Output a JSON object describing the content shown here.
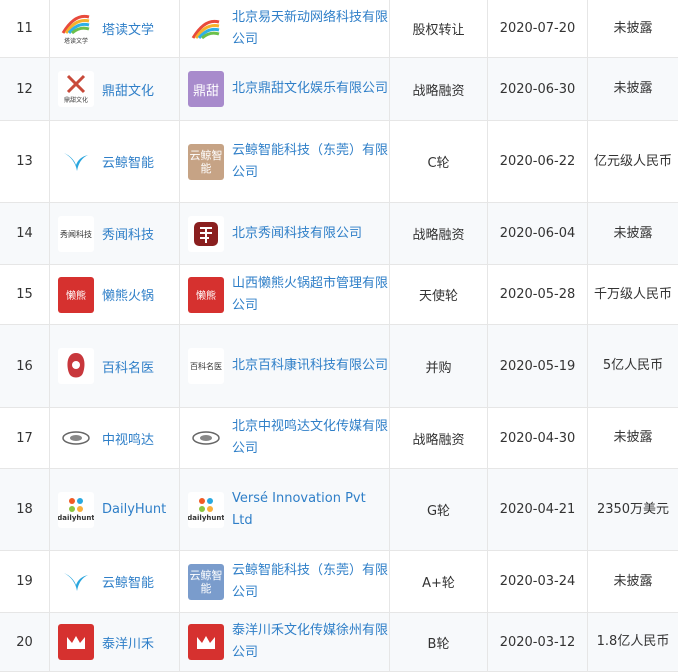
{
  "rows": [
    {
      "idx": "11",
      "project": "塔读文学",
      "company": "北京易天新动网络科技有限公司",
      "round": "股权转让",
      "date": "2020-07-20",
      "amount": "未披露",
      "proj_logo": "tadu-logo",
      "proj_logo_text": "塔读文学",
      "comp_logo": "tadu-logo"
    },
    {
      "idx": "12",
      "project": "鼎甜文化",
      "company": "北京鼎甜文化娱乐有限公司",
      "round": "战略融资",
      "date": "2020-06-30",
      "amount": "未披露",
      "proj_logo": "dingtian-logo",
      "proj_logo_text": "鼎甜文化",
      "comp_logo": "dingtian-tile",
      "comp_logo_text": "鼎甜"
    },
    {
      "idx": "13",
      "project": "云鲸智能",
      "company": "云鲸智能科技（东莞）有限公司",
      "round": "C轮",
      "date": "2020-06-22",
      "amount": "亿元级人民币",
      "proj_logo": "yunjing-logo",
      "comp_logo": "yunjing-tile",
      "comp_logo_text": "云鲸智能"
    },
    {
      "idx": "14",
      "project": "秀闻科技",
      "company": "北京秀闻科技有限公司",
      "round": "战略融资",
      "date": "2020-06-04",
      "amount": "未披露",
      "proj_logo": "xiuwen-logo",
      "proj_logo_text": "秀闻科技",
      "comp_logo": "xiuwen-tile"
    },
    {
      "idx": "15",
      "project": "懒熊火锅",
      "company": "山西懒熊火锅超市管理有限公司",
      "round": "天使轮",
      "date": "2020-05-28",
      "amount": "千万级人民币",
      "proj_logo": "lanxiong-logo",
      "proj_logo_text": "懒熊",
      "comp_logo": "lanxiong-tile",
      "comp_logo_text": "懒熊"
    },
    {
      "idx": "16",
      "project": "百科名医",
      "company": "北京百科康讯科技有限公司",
      "round": "并购",
      "date": "2020-05-19",
      "amount": "5亿人民币",
      "proj_logo": "baike-logo",
      "comp_logo": "baike-wordmark",
      "comp_logo_text": "百科名医"
    },
    {
      "idx": "17",
      "project": "中视鸣达",
      "company": "北京中视鸣达文化传媒有限公司",
      "round": "战略融资",
      "date": "2020-04-30",
      "amount": "未披露",
      "proj_logo": "zhongshi-logo",
      "comp_logo": "zhongshi-logo"
    },
    {
      "idx": "18",
      "project": "DailyHunt",
      "company": "Versé Innovation Pvt Ltd",
      "round": "G轮",
      "date": "2020-04-21",
      "amount": "2350万美元",
      "proj_logo": "dailyhunt-logo",
      "proj_logo_text": "dailyhunt",
      "comp_logo": "dailyhunt-logo",
      "comp_logo_text": "dailyhunt"
    },
    {
      "idx": "19",
      "project": "云鲸智能",
      "company": "云鲸智能科技（东莞）有限公司",
      "round": "A+轮",
      "date": "2020-03-24",
      "amount": "未披露",
      "proj_logo": "yunjing-logo",
      "comp_logo": "yunjing-tile",
      "comp_logo_text": "云鲸智能"
    },
    {
      "idx": "20",
      "project": "泰洋川禾",
      "company": "泰洋川禾文化传媒徐州有限公司",
      "round": "B轮",
      "date": "2020-03-12",
      "amount": "1.8亿人民币",
      "proj_logo": "taiyang-logo",
      "comp_logo": "taiyang-logo"
    }
  ],
  "colors": {
    "link": "#2f7fc8",
    "text": "#333333",
    "border": "#e6e6e6"
  }
}
